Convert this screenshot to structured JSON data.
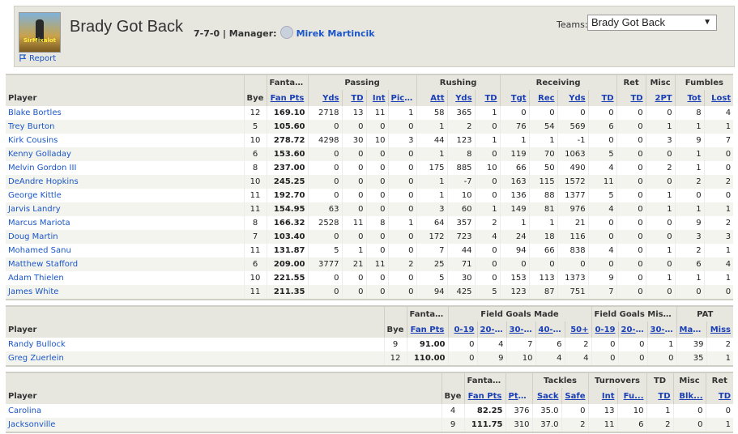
{
  "header": {
    "team_name": "Brady Got Back",
    "record": "7-7-0",
    "manager_label": "| Manager:",
    "manager_name": "Mirek Martincik",
    "report_label": "Report",
    "logo_text": "SirMixalot",
    "teams_label": "Teams:",
    "teams_selected": "Brady Got Back"
  },
  "offense": {
    "groups": [
      "Fantasy",
      "Passing",
      "Rushing",
      "Receiving",
      "Ret",
      "Misc",
      "Fumbles"
    ],
    "columns": [
      "Player",
      "Bye",
      "Fan Pts",
      "Yds",
      "TD",
      "Int",
      "Pic...",
      "Att",
      "Yds",
      "TD",
      "Tgt",
      "Rec",
      "Yds",
      "TD",
      "TD",
      "2PT",
      "Tot",
      "Lost"
    ],
    "rows": [
      [
        "Blake Bortles",
        "12",
        "169.10",
        "2718",
        "13",
        "11",
        "1",
        "58",
        "365",
        "1",
        "0",
        "0",
        "0",
        "0",
        "0",
        "0",
        "8",
        "4"
      ],
      [
        "Trey Burton",
        "5",
        "105.60",
        "0",
        "0",
        "0",
        "0",
        "1",
        "2",
        "0",
        "76",
        "54",
        "569",
        "6",
        "0",
        "1",
        "1",
        "1"
      ],
      [
        "Kirk Cousins",
        "10",
        "278.72",
        "4298",
        "30",
        "10",
        "3",
        "44",
        "123",
        "1",
        "1",
        "1",
        "-1",
        "0",
        "0",
        "3",
        "9",
        "7"
      ],
      [
        "Kenny Golladay",
        "6",
        "153.60",
        "0",
        "0",
        "0",
        "0",
        "1",
        "8",
        "0",
        "119",
        "70",
        "1063",
        "5",
        "0",
        "0",
        "1",
        "0"
      ],
      [
        "Melvin Gordon III",
        "8",
        "237.00",
        "0",
        "0",
        "0",
        "0",
        "175",
        "885",
        "10",
        "66",
        "50",
        "490",
        "4",
        "0",
        "2",
        "1",
        "0"
      ],
      [
        "DeAndre Hopkins",
        "10",
        "245.25",
        "0",
        "0",
        "0",
        "0",
        "1",
        "-7",
        "0",
        "163",
        "115",
        "1572",
        "11",
        "0",
        "0",
        "2",
        "2"
      ],
      [
        "George Kittle",
        "11",
        "192.70",
        "0",
        "0",
        "0",
        "0",
        "1",
        "10",
        "0",
        "136",
        "88",
        "1377",
        "5",
        "0",
        "1",
        "0",
        "0"
      ],
      [
        "Jarvis Landry",
        "11",
        "154.95",
        "63",
        "0",
        "0",
        "0",
        "3",
        "60",
        "1",
        "149",
        "81",
        "976",
        "4",
        "0",
        "1",
        "1",
        "1"
      ],
      [
        "Marcus Mariota",
        "8",
        "166.32",
        "2528",
        "11",
        "8",
        "1",
        "64",
        "357",
        "2",
        "1",
        "1",
        "21",
        "0",
        "0",
        "0",
        "9",
        "2"
      ],
      [
        "Doug Martin",
        "7",
        "103.40",
        "0",
        "0",
        "0",
        "0",
        "172",
        "723",
        "4",
        "24",
        "18",
        "116",
        "0",
        "0",
        "0",
        "3",
        "3"
      ],
      [
        "Mohamed Sanu",
        "11",
        "131.87",
        "5",
        "1",
        "0",
        "0",
        "7",
        "44",
        "0",
        "94",
        "66",
        "838",
        "4",
        "0",
        "1",
        "2",
        "1"
      ],
      [
        "Matthew Stafford",
        "6",
        "209.00",
        "3777",
        "21",
        "11",
        "2",
        "25",
        "71",
        "0",
        "0",
        "0",
        "0",
        "0",
        "0",
        "0",
        "6",
        "4"
      ],
      [
        "Adam Thielen",
        "10",
        "221.55",
        "0",
        "0",
        "0",
        "0",
        "5",
        "30",
        "0",
        "153",
        "113",
        "1373",
        "9",
        "0",
        "1",
        "1",
        "1"
      ],
      [
        "James White",
        "11",
        "211.35",
        "0",
        "0",
        "0",
        "0",
        "94",
        "425",
        "5",
        "123",
        "87",
        "751",
        "7",
        "0",
        "0",
        "0",
        "0"
      ]
    ]
  },
  "kickers": {
    "groups": [
      "Fantasy",
      "Field Goals Made",
      "Field Goals Missed",
      "PAT"
    ],
    "columns": [
      "Player",
      "Bye",
      "Fan Pts",
      "0-19",
      "20-29",
      "30-39",
      "40-49",
      "50+",
      "0-19",
      "20-29",
      "30-39",
      "Made",
      "Miss"
    ],
    "rows": [
      [
        "Randy Bullock",
        "9",
        "91.00",
        "0",
        "4",
        "7",
        "6",
        "2",
        "0",
        "0",
        "1",
        "39",
        "2"
      ],
      [
        "Greg Zuerlein",
        "12",
        "110.00",
        "0",
        "9",
        "10",
        "4",
        "4",
        "0",
        "0",
        "0",
        "35",
        "1"
      ]
    ]
  },
  "defense": {
    "groups": [
      "Fantasy",
      "Tackles",
      "Turnovers",
      "TD",
      "Misc",
      "Ret"
    ],
    "columns": [
      "Player",
      "Bye",
      "Fan Pts",
      "Pts...",
      "Sack",
      "Safe",
      "Int",
      "Fu...",
      "TD",
      "Blk...",
      "TD"
    ],
    "rows": [
      [
        "Carolina",
        "4",
        "82.25",
        "376",
        "35.0",
        "0",
        "13",
        "10",
        "1",
        "0",
        "0"
      ],
      [
        "Jacksonville",
        "9",
        "111.75",
        "310",
        "37.0",
        "2",
        "11",
        "6",
        "2",
        "0",
        "1"
      ]
    ]
  }
}
